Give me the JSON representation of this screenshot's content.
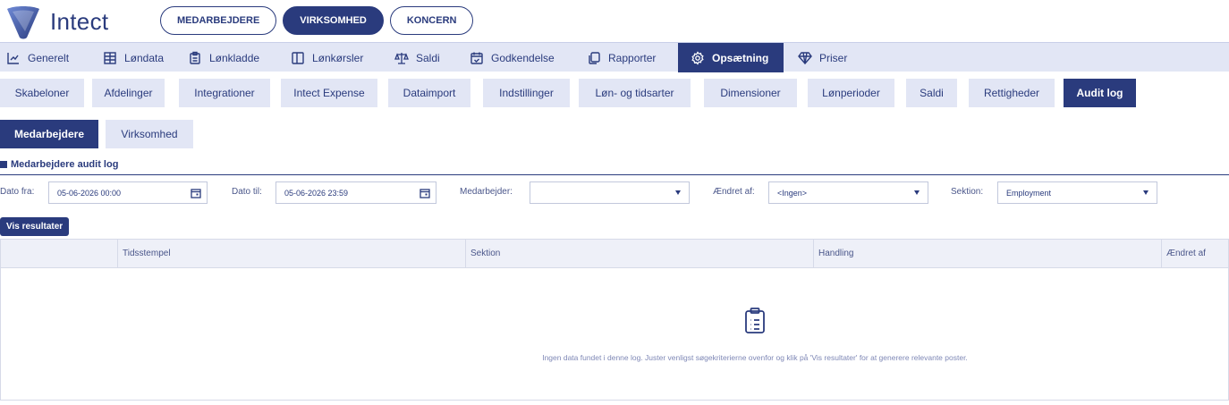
{
  "brand": {
    "name": "Intect"
  },
  "top_nav": [
    {
      "label": "MEDARBEJDERE",
      "active": false
    },
    {
      "label": "VIRKSOMHED",
      "active": true
    },
    {
      "label": "KONCERN",
      "active": false
    }
  ],
  "main_nav": [
    {
      "label": "Generelt",
      "icon": "chart-icon"
    },
    {
      "label": "Løndata",
      "icon": "table-icon"
    },
    {
      "label": "Lønkladde",
      "icon": "clipboard-icon"
    },
    {
      "label": "Lønkørsler",
      "icon": "columns-icon"
    },
    {
      "label": "Saldi",
      "icon": "scale-icon"
    },
    {
      "label": "Godkendelse",
      "icon": "calendar-check-icon"
    },
    {
      "label": "Rapporter",
      "icon": "copy-icon"
    },
    {
      "label": "Opsætning",
      "icon": "gear-icon",
      "active": true
    },
    {
      "label": "Priser",
      "icon": "diamond-icon"
    }
  ],
  "sub_tabs": [
    {
      "label": "Skabeloner"
    },
    {
      "label": "Afdelinger"
    },
    {
      "label": "Integrationer"
    },
    {
      "label": "Intect Expense"
    },
    {
      "label": "Dataimport"
    },
    {
      "label": "Indstillinger"
    },
    {
      "label": "Løn- og tidsarter"
    },
    {
      "label": "Dimensioner"
    },
    {
      "label": "Lønperioder"
    },
    {
      "label": "Saldi"
    },
    {
      "label": "Rettigheder"
    },
    {
      "label": "Audit log",
      "active": true
    }
  ],
  "level3_tabs": [
    {
      "label": "Medarbejdere",
      "active": true
    },
    {
      "label": "Virksomhed"
    }
  ],
  "section_title": "Medarbejdere audit log",
  "filters": {
    "date_from_label": "Dato fra:",
    "date_from_value": "05-06-2026 00:00",
    "date_to_label": "Dato til:",
    "date_to_value": "05-06-2026 23:59",
    "employee_label": "Medarbejder:",
    "employee_value": "",
    "changed_by_label": "Ændret af:",
    "changed_by_value": "<Ingen>",
    "section_label": "Sektion:",
    "section_value": "Employment"
  },
  "show_results_label": "Vis resultater",
  "table": {
    "columns": [
      "Tidsstempel",
      "Sektion",
      "Handling",
      "Ændret af"
    ],
    "empty_message": "Ingen data fundet i denne log. Juster venligst søgekriterierne ovenfor og klik på 'Vis resultater' for at generere relevante poster."
  },
  "colors": {
    "primary": "#2a3b7d",
    "nav_bg": "#e2e6f5"
  }
}
